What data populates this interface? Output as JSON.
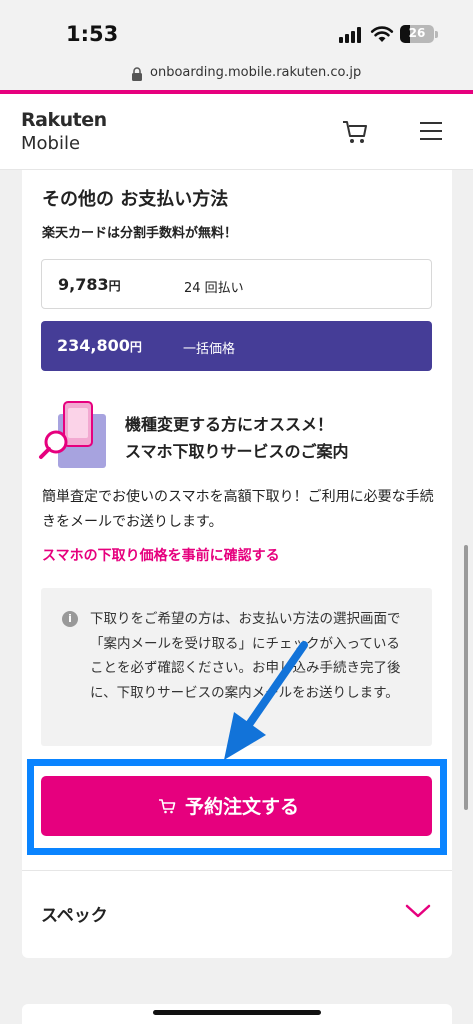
{
  "status_bar": {
    "time": "1:53",
    "battery": "26"
  },
  "browser": {
    "url": "onboarding.mobile.rakuten.co.jp"
  },
  "header": {
    "logo_line1": "Rakuten",
    "logo_line2": "Mobile"
  },
  "payment": {
    "title": "その他の お支払い方法",
    "subtitle": "楽天カードは分割手数料が無料！",
    "options": [
      {
        "amount": "9,783",
        "currency": "円",
        "label": "24 回払い",
        "selected": false
      },
      {
        "amount": "234,800",
        "currency": "円",
        "label": "一括価格",
        "selected": true
      }
    ]
  },
  "tradein": {
    "title_line1": "機種変更する方にオススメ！",
    "title_line2": "スマホ下取りサービスのご案内",
    "body": "簡単査定でお使いのスマホを高額下取り！ご利用に必要な手続きをメールでお送りします。",
    "link": "スマホの下取り価格を事前に確認する",
    "notice": "下取りをご希望の方は、お支払い方法の選択画面で「案内メールを受け取る」にチェックが入っていることを必ず確認ください。お申し込み手続き完了後に、下取りサービスの案内メールをお送りします。"
  },
  "order_button": {
    "label": "予約注文する"
  },
  "spec": {
    "title": "スペック"
  },
  "colors": {
    "accent": "#e6007e",
    "purple": "#453d97",
    "highlight": "#0a84ff"
  },
  "icons": [
    "lock-icon",
    "cart-icon",
    "menu-icon",
    "info-icon",
    "chevron-down-icon",
    "signal-icon",
    "wifi-icon",
    "battery-icon"
  ]
}
